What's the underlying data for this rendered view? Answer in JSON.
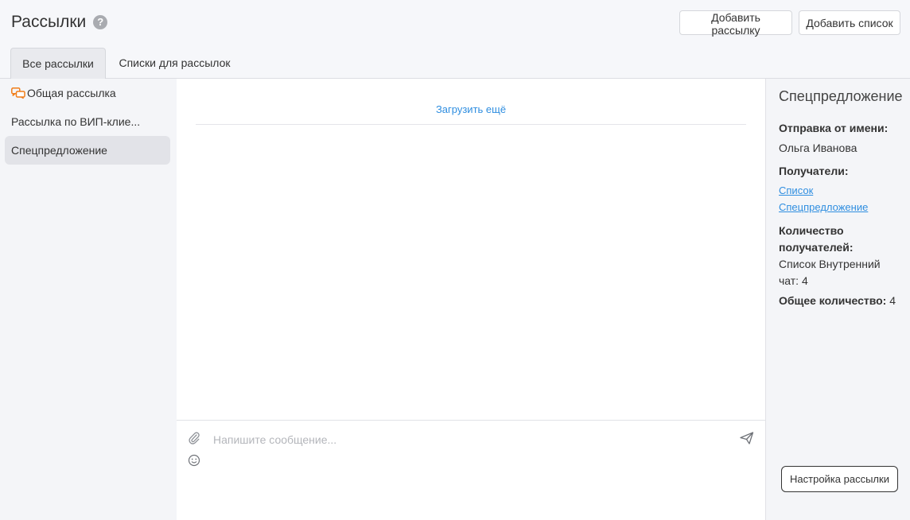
{
  "header": {
    "title": "Рассылки",
    "help_icon": "question-circle-icon",
    "add_mailing_label": "Добавить рассылку",
    "add_list_label": "Добавить список"
  },
  "tabs": [
    {
      "label": "Все рассылки",
      "active": true
    },
    {
      "label": "Списки для рассылок",
      "active": false
    }
  ],
  "sidebar": {
    "items": [
      {
        "label": "Общая рассылка",
        "icon": "chat-bubbles-icon",
        "icon_color": "#f07d19"
      },
      {
        "label": "Рассылка по ВИП-клие...",
        "selected": false
      },
      {
        "label": "Спецпредложение",
        "selected": true
      }
    ]
  },
  "main": {
    "load_more": "Загрузить ещё"
  },
  "composer": {
    "placeholder": "Напишите сообщение...",
    "attach_icon": "paperclip-icon",
    "emoji_icon": "smile-icon",
    "send_icon": "send-icon"
  },
  "details": {
    "title": "Спецпредложение",
    "sender_label": "Отправка от имени:",
    "sender_value": "Ольга Иванова",
    "recipients_label": "Получатели:",
    "recipients_links": [
      "Список",
      "Спецпредложение"
    ],
    "count_label_line1": "Количество",
    "count_label_line2": "получателей:",
    "count_value_line1": "Список Внутренний",
    "count_value_line2": "чат: 4",
    "total_label": "Общее количество:",
    "total_value": "4",
    "settings_button": "Настройка рассылки"
  },
  "colors": {
    "accent": "#2f8ee0",
    "chat_icon": "#f07d19",
    "selected_bg": "#e2e3e8"
  }
}
